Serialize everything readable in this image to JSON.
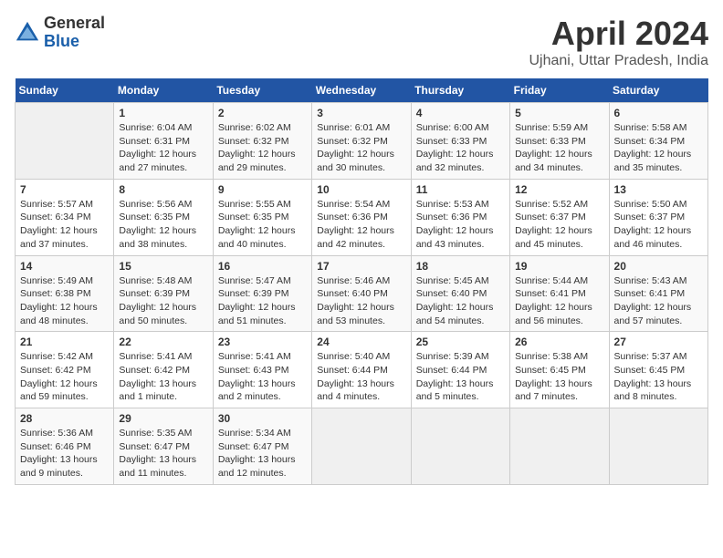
{
  "header": {
    "logo_general": "General",
    "logo_blue": "Blue",
    "title": "April 2024",
    "location": "Ujhani, Uttar Pradesh, India"
  },
  "weekdays": [
    "Sunday",
    "Monday",
    "Tuesday",
    "Wednesday",
    "Thursday",
    "Friday",
    "Saturday"
  ],
  "weeks": [
    [
      {
        "day": "",
        "info": ""
      },
      {
        "day": "1",
        "info": "Sunrise: 6:04 AM\nSunset: 6:31 PM\nDaylight: 12 hours\nand 27 minutes."
      },
      {
        "day": "2",
        "info": "Sunrise: 6:02 AM\nSunset: 6:32 PM\nDaylight: 12 hours\nand 29 minutes."
      },
      {
        "day": "3",
        "info": "Sunrise: 6:01 AM\nSunset: 6:32 PM\nDaylight: 12 hours\nand 30 minutes."
      },
      {
        "day": "4",
        "info": "Sunrise: 6:00 AM\nSunset: 6:33 PM\nDaylight: 12 hours\nand 32 minutes."
      },
      {
        "day": "5",
        "info": "Sunrise: 5:59 AM\nSunset: 6:33 PM\nDaylight: 12 hours\nand 34 minutes."
      },
      {
        "day": "6",
        "info": "Sunrise: 5:58 AM\nSunset: 6:34 PM\nDaylight: 12 hours\nand 35 minutes."
      }
    ],
    [
      {
        "day": "7",
        "info": "Sunrise: 5:57 AM\nSunset: 6:34 PM\nDaylight: 12 hours\nand 37 minutes."
      },
      {
        "day": "8",
        "info": "Sunrise: 5:56 AM\nSunset: 6:35 PM\nDaylight: 12 hours\nand 38 minutes."
      },
      {
        "day": "9",
        "info": "Sunrise: 5:55 AM\nSunset: 6:35 PM\nDaylight: 12 hours\nand 40 minutes."
      },
      {
        "day": "10",
        "info": "Sunrise: 5:54 AM\nSunset: 6:36 PM\nDaylight: 12 hours\nand 42 minutes."
      },
      {
        "day": "11",
        "info": "Sunrise: 5:53 AM\nSunset: 6:36 PM\nDaylight: 12 hours\nand 43 minutes."
      },
      {
        "day": "12",
        "info": "Sunrise: 5:52 AM\nSunset: 6:37 PM\nDaylight: 12 hours\nand 45 minutes."
      },
      {
        "day": "13",
        "info": "Sunrise: 5:50 AM\nSunset: 6:37 PM\nDaylight: 12 hours\nand 46 minutes."
      }
    ],
    [
      {
        "day": "14",
        "info": "Sunrise: 5:49 AM\nSunset: 6:38 PM\nDaylight: 12 hours\nand 48 minutes."
      },
      {
        "day": "15",
        "info": "Sunrise: 5:48 AM\nSunset: 6:39 PM\nDaylight: 12 hours\nand 50 minutes."
      },
      {
        "day": "16",
        "info": "Sunrise: 5:47 AM\nSunset: 6:39 PM\nDaylight: 12 hours\nand 51 minutes."
      },
      {
        "day": "17",
        "info": "Sunrise: 5:46 AM\nSunset: 6:40 PM\nDaylight: 12 hours\nand 53 minutes."
      },
      {
        "day": "18",
        "info": "Sunrise: 5:45 AM\nSunset: 6:40 PM\nDaylight: 12 hours\nand 54 minutes."
      },
      {
        "day": "19",
        "info": "Sunrise: 5:44 AM\nSunset: 6:41 PM\nDaylight: 12 hours\nand 56 minutes."
      },
      {
        "day": "20",
        "info": "Sunrise: 5:43 AM\nSunset: 6:41 PM\nDaylight: 12 hours\nand 57 minutes."
      }
    ],
    [
      {
        "day": "21",
        "info": "Sunrise: 5:42 AM\nSunset: 6:42 PM\nDaylight: 12 hours\nand 59 minutes."
      },
      {
        "day": "22",
        "info": "Sunrise: 5:41 AM\nSunset: 6:42 PM\nDaylight: 13 hours\nand 1 minute."
      },
      {
        "day": "23",
        "info": "Sunrise: 5:41 AM\nSunset: 6:43 PM\nDaylight: 13 hours\nand 2 minutes."
      },
      {
        "day": "24",
        "info": "Sunrise: 5:40 AM\nSunset: 6:44 PM\nDaylight: 13 hours\nand 4 minutes."
      },
      {
        "day": "25",
        "info": "Sunrise: 5:39 AM\nSunset: 6:44 PM\nDaylight: 13 hours\nand 5 minutes."
      },
      {
        "day": "26",
        "info": "Sunrise: 5:38 AM\nSunset: 6:45 PM\nDaylight: 13 hours\nand 7 minutes."
      },
      {
        "day": "27",
        "info": "Sunrise: 5:37 AM\nSunset: 6:45 PM\nDaylight: 13 hours\nand 8 minutes."
      }
    ],
    [
      {
        "day": "28",
        "info": "Sunrise: 5:36 AM\nSunset: 6:46 PM\nDaylight: 13 hours\nand 9 minutes."
      },
      {
        "day": "29",
        "info": "Sunrise: 5:35 AM\nSunset: 6:47 PM\nDaylight: 13 hours\nand 11 minutes."
      },
      {
        "day": "30",
        "info": "Sunrise: 5:34 AM\nSunset: 6:47 PM\nDaylight: 13 hours\nand 12 minutes."
      },
      {
        "day": "",
        "info": ""
      },
      {
        "day": "",
        "info": ""
      },
      {
        "day": "",
        "info": ""
      },
      {
        "day": "",
        "info": ""
      }
    ]
  ]
}
